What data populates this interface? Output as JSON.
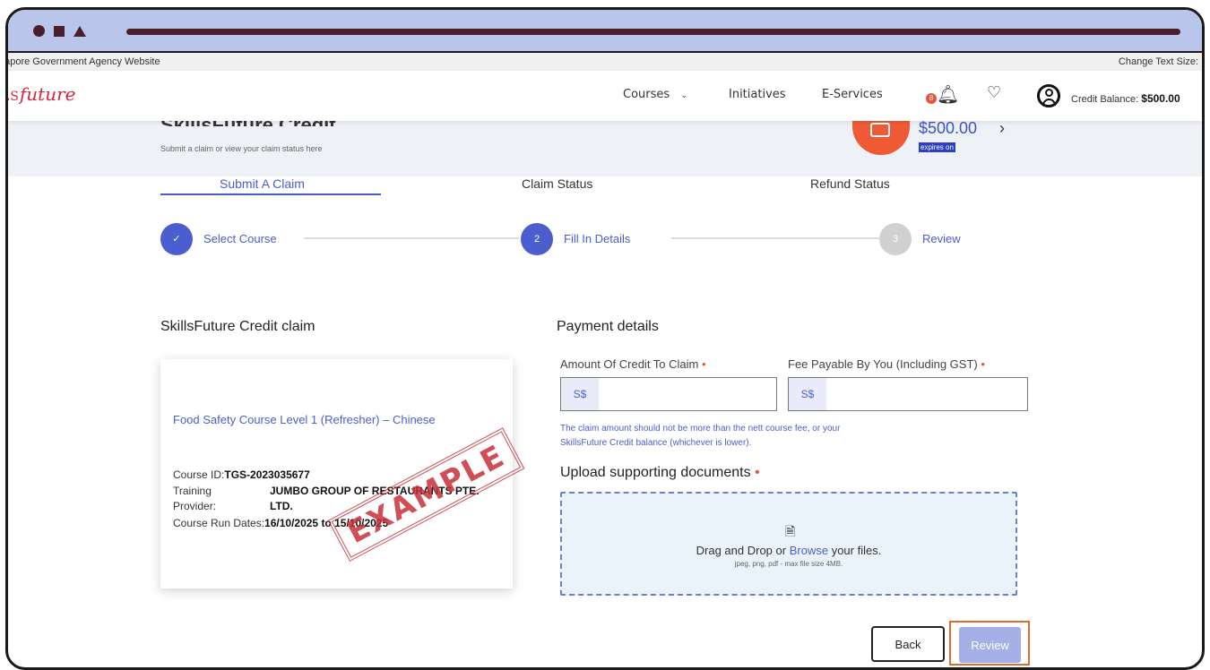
{
  "colors": {
    "accent": "#4b5ed0",
    "frame_bg": "#b9c5ea",
    "brand_red": "#d7263d",
    "orange": "#ef5a34",
    "stamp_red": "#c7303a"
  },
  "gov_bar": {
    "left": "gapore Government Agency Website",
    "right": "Change Text Size:"
  },
  "nav": {
    "logo_prefix": "LS",
    "logo_script": "future",
    "courses": "Courses",
    "courses_chevron": "⌄",
    "initiatives": "Initiatives",
    "eservices": "E-Services",
    "bell_badge": "8",
    "credit_label": "Credit Balance:",
    "credit_value": "$500.00",
    "icons": [
      "bell-icon",
      "heart-icon",
      "user-avatar-icon"
    ]
  },
  "hero": {
    "title": "SkillsFuture Credit",
    "subtitle": "Submit a claim or view your claim status here",
    "amount": "$500.00",
    "arrow": "›",
    "expires": "expires on"
  },
  "tabs": [
    "Submit A Claim",
    "Claim Status",
    "Refund Status"
  ],
  "steps": [
    {
      "label": "Select Course",
      "marker": "✓",
      "state": "done"
    },
    {
      "label": "Fill In Details",
      "marker": "2",
      "state": "current"
    },
    {
      "label": "Review",
      "marker": "3",
      "state": "pending"
    }
  ],
  "claim": {
    "heading": "SkillsFuture Credit claim",
    "course_title": "Food Safety Course Level 1 (Refresher) – Chinese",
    "course_id_label": "Course ID:",
    "course_id": "TGS-2023035677",
    "provider_label_1": "Training",
    "provider_label_2": "Provider:",
    "provider_1": "JUMBO GROUP OF RESTAURANTS PTE.",
    "provider_2": "LTD.",
    "run_dates_label": "Course Run Dates:",
    "run_dates": "16/10/2025 to 15/10/2025",
    "stamp": "EXAMPLE"
  },
  "payment": {
    "heading": "Payment details",
    "amount_label": "Amount Of Credit To Claim",
    "fee_label": "Fee Payable By You (Including GST)",
    "required_mark": "•",
    "currency_prefix": "S$",
    "amount_value": "",
    "fee_value": "",
    "hint_1": "The claim amount should not be more than the nett course fee, or your",
    "hint_2": "SkillsFuture Credit balance (whichever is lower)."
  },
  "upload": {
    "heading": "Upload supporting documents",
    "drag_text": "Drag and Drop or",
    "browse_link": "Browse",
    "files_text": "your files.",
    "formats": "jpeg, png, pdf - max file size 4MB."
  },
  "buttons": {
    "back": "Back",
    "review": "Review"
  }
}
